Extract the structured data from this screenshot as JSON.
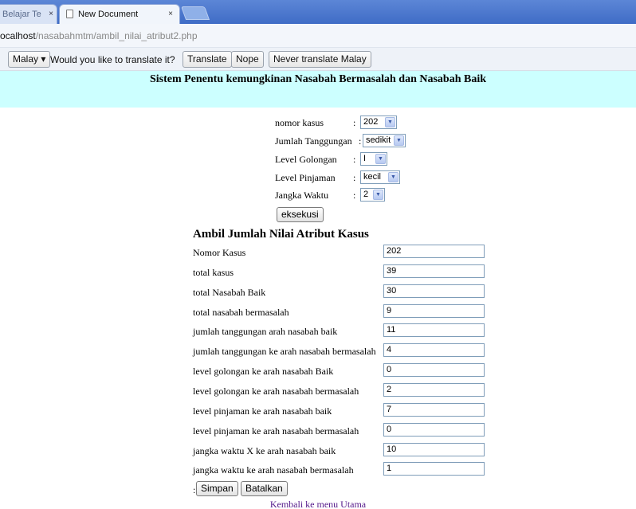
{
  "browser": {
    "tabs": [
      {
        "label": "Belajar Te",
        "active": false
      },
      {
        "label": "New Document",
        "active": true
      }
    ],
    "close_glyph": "×",
    "url_host": "ocalhost",
    "url_path": "/nasabahmtm/ambil_nilai_atribut2.php"
  },
  "translate_bar": {
    "language_button": "Malay ▾",
    "prompt": "Would you like to translate it?",
    "translate_button": "Translate",
    "nope_button": "Nope",
    "never_button": "Never translate Malay"
  },
  "header": {
    "title": "Sistem Penentu kemungkinan Nasabah Bermasalah dan Nasabah Baik",
    "background": "#ccffff"
  },
  "form": {
    "fields": [
      {
        "label": "nomor kasus",
        "colon": ":",
        "value": "202"
      },
      {
        "label": "Jumlah Tanggungan",
        "colon": ":",
        "value": "sedikit"
      },
      {
        "label": "Level Golongan",
        "colon": ":",
        "value": "I"
      },
      {
        "label": "Level Pinjaman",
        "colon": ":",
        "value": "kecil"
      },
      {
        "label": "Jangka Waktu",
        "colon": ":",
        "value": "2"
      }
    ],
    "submit_label": "eksekusi"
  },
  "result": {
    "title": "Ambil Jumlah Nilai Atribut Kasus",
    "rows": [
      {
        "label": "Nomor Kasus",
        "value": "202"
      },
      {
        "label": "total kasus",
        "value": "39"
      },
      {
        "label": "total Nasabah Baik",
        "value": "30"
      },
      {
        "label": "total nasabah bermasalah",
        "value": "9"
      },
      {
        "label": "jumlah tanggungan arah nasabah baik",
        "value": "11"
      },
      {
        "label": "jumlah tanggungan ke arah nasabah bermasalah",
        "value": "4"
      },
      {
        "label": "level golongan ke arah nasabah Baik",
        "value": "0"
      },
      {
        "label": "level golongan ke arah nasabah bermasalah",
        "value": "2"
      },
      {
        "label": "level pinjaman ke arah nasabah baik",
        "value": "7"
      },
      {
        "label": "level pinjaman ke arah nasabah bermasalah",
        "value": "0"
      },
      {
        "label": "jangka waktu X ke arah nasabah baik",
        "value": "10"
      },
      {
        "label": "jangka waktu ke arah nasabah bermasalah",
        "value": "1"
      }
    ],
    "colon": ":",
    "save_label": "Simpan",
    "cancel_label": "Batalkan"
  },
  "footer": {
    "link_text": "Kembali ke menu Utama"
  }
}
